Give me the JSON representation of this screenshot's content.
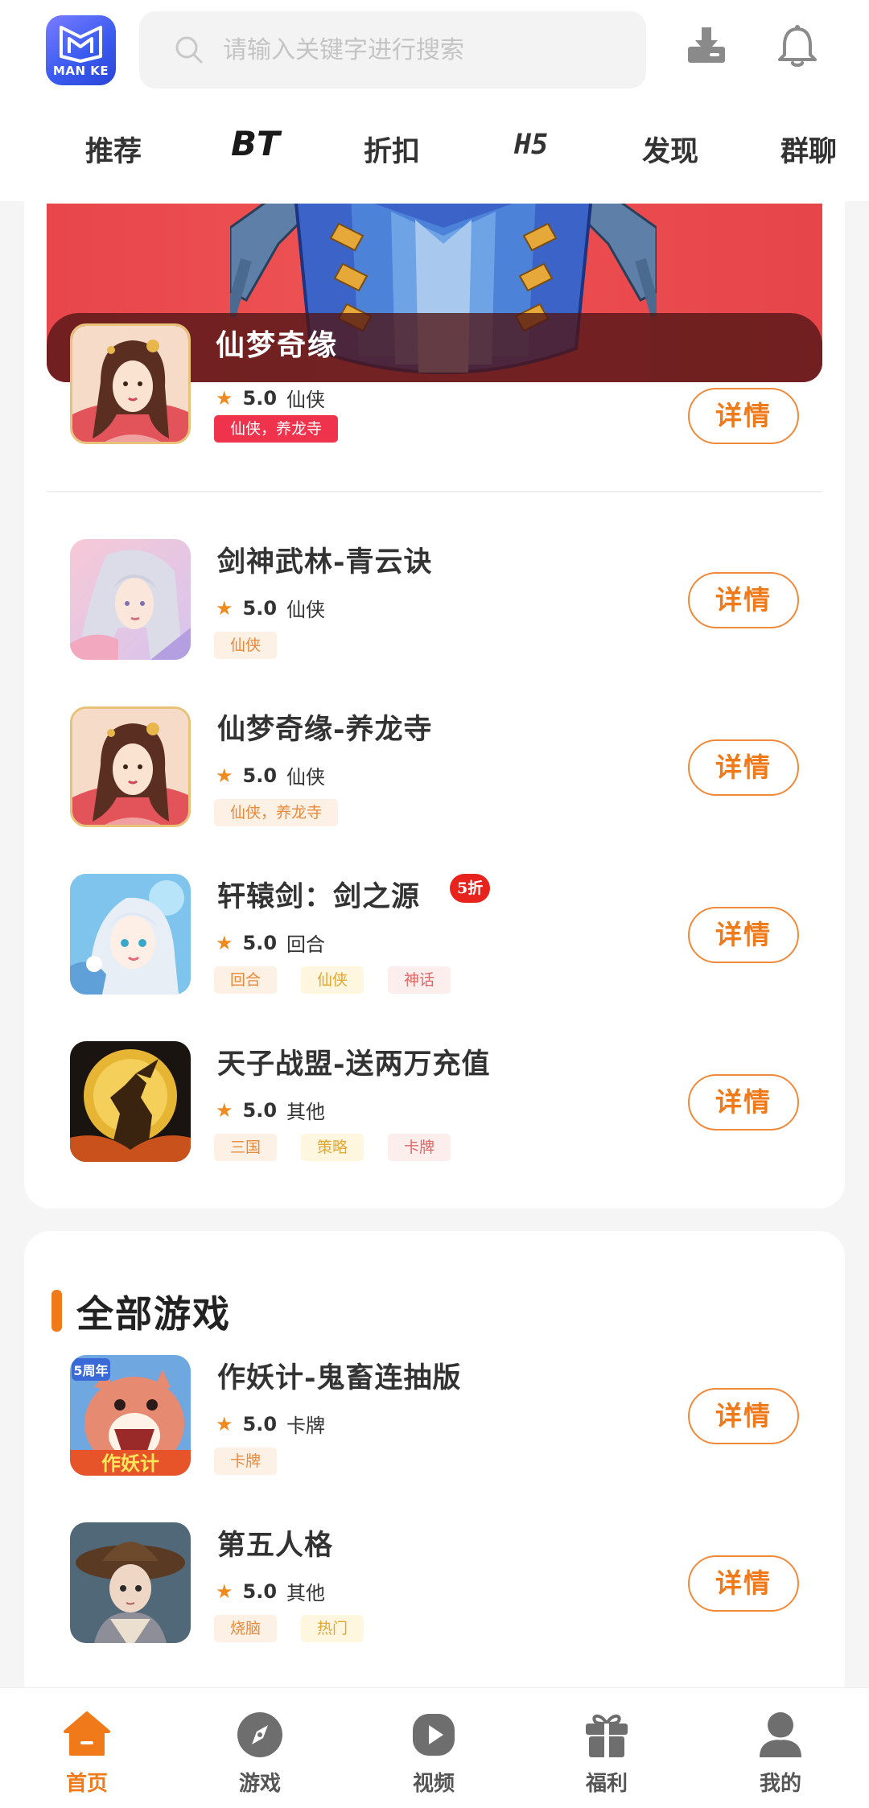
{
  "header": {
    "logo_text": "MAN KE",
    "search_placeholder": "请输入关键字进行搜索"
  },
  "tabs": [
    {
      "label": "推荐"
    },
    {
      "label": "BT"
    },
    {
      "label": "折扣"
    },
    {
      "label": "H5"
    },
    {
      "label": "发现"
    },
    {
      "label": "群聊"
    }
  ],
  "featured": {
    "title": "仙梦奇缘",
    "score": "5.0",
    "category": "仙侠",
    "tag": "仙侠，养龙寺",
    "button": "详情"
  },
  "games": [
    {
      "title": "剑神武林-青云诀",
      "score": "5.0",
      "category": "仙侠",
      "tags": [
        "仙侠"
      ],
      "button": "详情"
    },
    {
      "title": "仙梦奇缘-养龙寺",
      "score": "5.0",
      "category": "仙侠",
      "tags": [
        "仙侠，养龙寺"
      ],
      "button": "详情"
    },
    {
      "title": "轩辕剑：剑之源",
      "score": "5.0",
      "category": "回合",
      "tags": [
        "回合",
        "仙侠",
        "神话"
      ],
      "discount": "5折",
      "button": "详情"
    },
    {
      "title": "天子战盟-送两万充值",
      "score": "5.0",
      "category": "其他",
      "tags": [
        "三国",
        "策略",
        "卡牌"
      ],
      "button": "详情"
    }
  ],
  "all_games": {
    "section_title": "全部游戏",
    "items": [
      {
        "title": "作妖计-鬼畜连抽版",
        "score": "5.0",
        "category": "卡牌",
        "tags": [
          "卡牌"
        ],
        "icon_badge": "5周年",
        "icon_text": "作妖计",
        "button": "详情"
      },
      {
        "title": "第五人格",
        "score": "5.0",
        "category": "其他",
        "tags": [
          "烧脑",
          "热门"
        ],
        "button": "详情"
      }
    ]
  },
  "bottom_nav": [
    {
      "label": "首页",
      "active": true
    },
    {
      "label": "游戏"
    },
    {
      "label": "视频"
    },
    {
      "label": "福利"
    },
    {
      "label": "我的"
    }
  ],
  "colors": {
    "accent": "#f07a1a",
    "banner_red": "#ec4d51",
    "discount_red": "#e8231d"
  }
}
